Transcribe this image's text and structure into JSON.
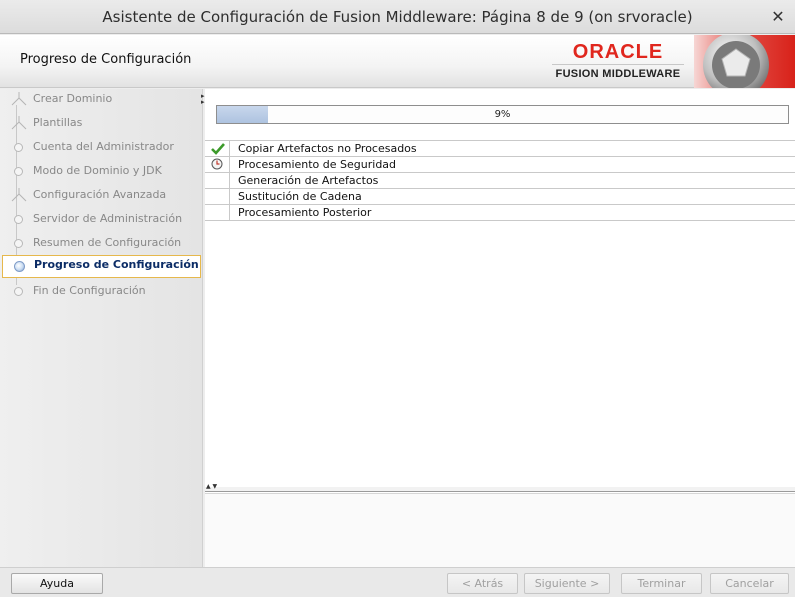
{
  "window": {
    "title": "Asistente de Configuración de Fusion Middleware: Página 8 de 9 (on srvoracle)",
    "close_icon": "close-icon"
  },
  "header": {
    "page_title": "Progreso de Configuración",
    "logo_brand": "ORACLE",
    "logo_sub": "FUSION MIDDLEWARE"
  },
  "nav": {
    "items": [
      {
        "label": "Crear Dominio",
        "state": "done",
        "icon": "fork-icon"
      },
      {
        "label": "Plantillas",
        "state": "done",
        "icon": "fork-icon"
      },
      {
        "label": "Cuenta del Administrador",
        "state": "done",
        "icon": "step-dot-icon"
      },
      {
        "label": "Modo de Dominio y JDK",
        "state": "done",
        "icon": "step-dot-icon"
      },
      {
        "label": "Configuración Avanzada",
        "state": "done",
        "icon": "fork-icon"
      },
      {
        "label": "Servidor de Administración",
        "state": "done",
        "icon": "step-dot-icon"
      },
      {
        "label": "Resumen de Configuración",
        "state": "done",
        "icon": "step-dot-icon"
      },
      {
        "label": "Progreso de Configuración",
        "state": "current",
        "icon": "current-step-icon"
      },
      {
        "label": "Fin de Configuración",
        "state": "pending",
        "icon": "step-dot-icon"
      }
    ]
  },
  "progress": {
    "percent": 9,
    "label": "9%"
  },
  "tasks": [
    {
      "name": "Copiar Artefactos no Procesados",
      "status": "completed",
      "icon": "checkmark-icon"
    },
    {
      "name": "Procesamiento de Seguridad",
      "status": "in-progress",
      "icon": "clock-icon"
    },
    {
      "name": "Generación de Artefactos",
      "status": "pending",
      "icon": ""
    },
    {
      "name": "Sustitución de Cadena",
      "status": "pending",
      "icon": ""
    },
    {
      "name": "Procesamiento Posterior",
      "status": "pending",
      "icon": ""
    }
  ],
  "buttons": {
    "help": "Ayuda",
    "back": "< Atrás",
    "next": "Siguiente >",
    "finish": "Terminar",
    "cancel": "Cancelar"
  },
  "colors": {
    "oracle_red": "#e0261d",
    "current_step_border": "#e6b84c",
    "current_step_text": "#0b2c66",
    "checkmark_green": "#3c9a2a"
  }
}
